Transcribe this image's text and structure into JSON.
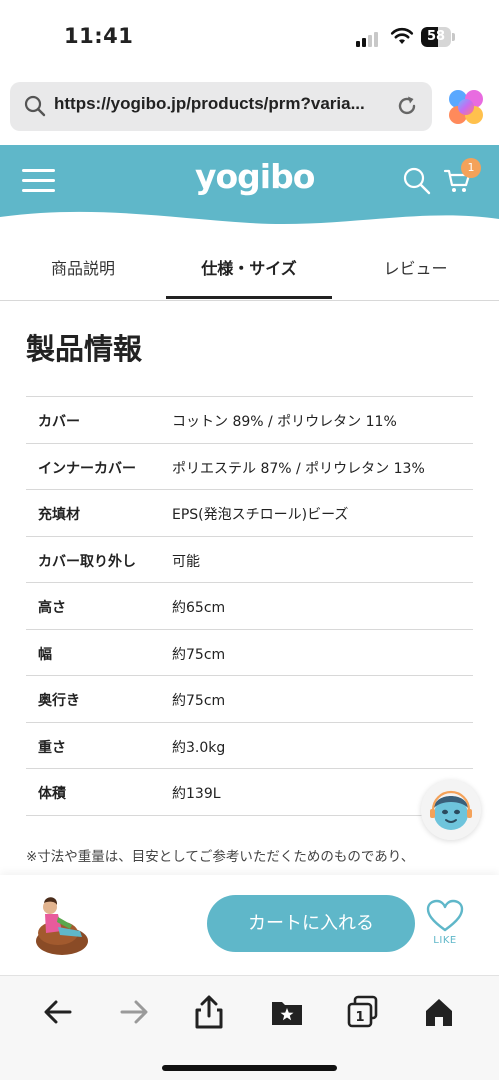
{
  "status_bar": {
    "time": "11:41",
    "battery": "58",
    "battery_level_percent": 58
  },
  "browser": {
    "url": "https://yogibo.jp/products/prm?varia..."
  },
  "header": {
    "logo": "yogibo",
    "cart_count": "1"
  },
  "tabs": [
    {
      "label": "商品説明",
      "active": false
    },
    {
      "label": "仕様・サイズ",
      "active": true
    },
    {
      "label": "レビュー",
      "active": false
    }
  ],
  "section_title": "製品情報",
  "specs": [
    {
      "label": "カバー",
      "value": "コットン 89% / ポリウレタン 11%"
    },
    {
      "label": "インナーカバー",
      "value": "ポリエステル 87% / ポリウレタン 13%"
    },
    {
      "label": "充填材",
      "value": "EPS(発泡スチロール)ビーズ"
    },
    {
      "label": "カバー取り外し",
      "value": "可能"
    },
    {
      "label": "高さ",
      "value": "約65cm"
    },
    {
      "label": "幅",
      "value": "約75cm"
    },
    {
      "label": "奥行き",
      "value": "約75cm"
    },
    {
      "label": "重さ",
      "value": "約3.0kg"
    },
    {
      "label": "体積",
      "value": "約139L"
    }
  ],
  "footnote": "※寸法や重量は、目安としてご参考いただくためのものであり、",
  "purchase": {
    "cart_button": "カートに入れる",
    "like_label": "LIKE"
  },
  "colors": {
    "brand": "#5fb7c9",
    "badge": "#f4a25a",
    "text": "#222222"
  },
  "toolbar_icons": [
    "back-arrow-icon",
    "forward-arrow-icon",
    "share-icon",
    "bookmarks-icon",
    "tabs-icon",
    "home-icon"
  ],
  "toolbar_tabs_count": "1"
}
